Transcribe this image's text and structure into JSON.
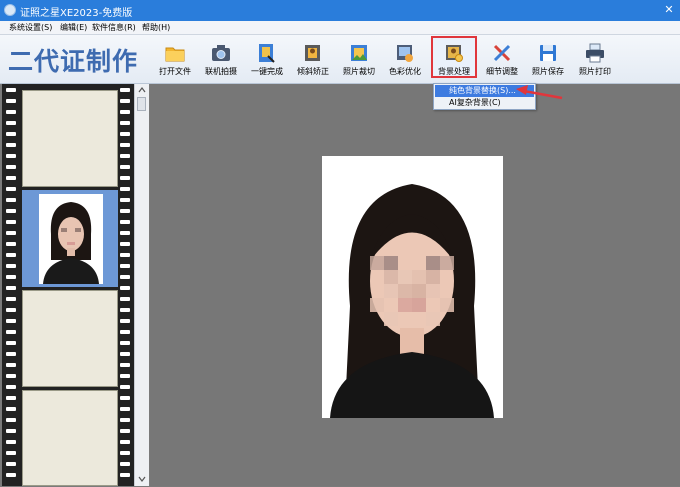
{
  "window": {
    "title": "证照之星XE2023-免费版",
    "close_symbol": "✕"
  },
  "menu": [
    {
      "label": "系统设置(S)"
    },
    {
      "label": "编辑(E)"
    },
    {
      "label": "软件信息(R)"
    },
    {
      "label": "帮助(H)"
    }
  ],
  "brand": "二代证制作",
  "toolbar": {
    "tools": [
      {
        "label": "打开文件",
        "icon": "folder-icon"
      },
      {
        "label": "联机拍摄",
        "icon": "camera-icon"
      },
      {
        "label": "一键完成",
        "icon": "one-click-icon"
      },
      {
        "label": "倾斜矫正",
        "icon": "tilt-correct-icon"
      },
      {
        "label": "照片裁切",
        "icon": "crop-icon"
      },
      {
        "label": "色彩优化",
        "icon": "color-icon"
      },
      {
        "label": "背景处理",
        "icon": "background-icon"
      },
      {
        "label": "细节调整",
        "icon": "detail-icon"
      },
      {
        "label": "照片保存",
        "icon": "save-icon"
      },
      {
        "label": "照片打印",
        "icon": "print-icon"
      }
    ]
  },
  "dropdown": {
    "items": [
      {
        "label": "纯色背景替换(S)..."
      },
      {
        "label": "AI复杂背景(C)"
      }
    ]
  },
  "colors": {
    "titlebar": "#2a7ddb",
    "highlight": "#3d7be0",
    "brand": "#3e6bb0",
    "annotation_red": "#e0363c"
  }
}
